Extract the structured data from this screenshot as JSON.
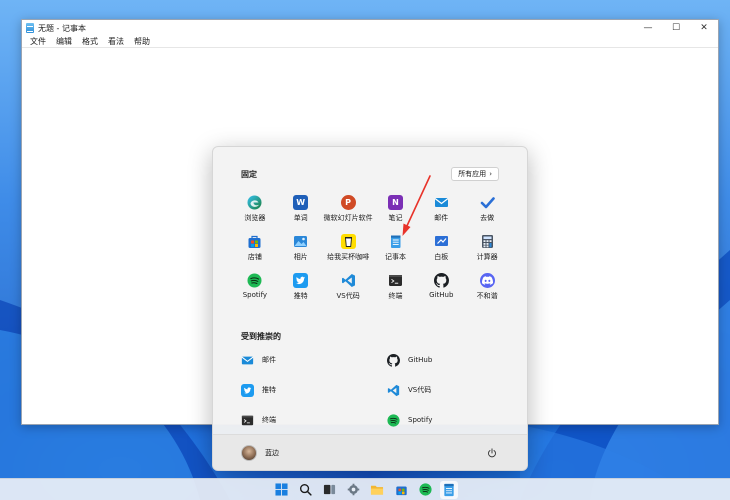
{
  "notepad": {
    "title": "无题 - 记事本",
    "menu": [
      "文件",
      "编辑",
      "格式",
      "看法",
      "帮助"
    ],
    "controls": {
      "minimize": "—",
      "maximize": "☐",
      "close": "✕"
    }
  },
  "start_menu": {
    "pinned_title": "固定",
    "all_apps_label": "所有应用",
    "all_apps_chevron": "›",
    "pinned": [
      {
        "label": "浏览器",
        "icon": "edge-icon"
      },
      {
        "label": "单词",
        "icon": "word-icon"
      },
      {
        "label": "微软幻灯片软件",
        "icon": "powerpoint-icon"
      },
      {
        "label": "笔记",
        "icon": "onenote-icon"
      },
      {
        "label": "邮件",
        "icon": "mail-icon"
      },
      {
        "label": "去做",
        "icon": "todo-icon"
      },
      {
        "label": "店铺",
        "icon": "store-icon"
      },
      {
        "label": "相片",
        "icon": "photos-icon"
      },
      {
        "label": "给我买杯咖啡",
        "icon": "coffee-icon"
      },
      {
        "label": "记事本",
        "icon": "notepad-icon"
      },
      {
        "label": "白板",
        "icon": "whiteboard-icon"
      },
      {
        "label": "计算器",
        "icon": "calculator-icon"
      },
      {
        "label": "Spotify",
        "icon": "spotify-icon"
      },
      {
        "label": "推特",
        "icon": "twitter-icon"
      },
      {
        "label": "VS代码",
        "icon": "vscode-icon"
      },
      {
        "label": "终端",
        "icon": "terminal-icon"
      },
      {
        "label": "GitHub",
        "icon": "github-icon"
      },
      {
        "label": "不和谐",
        "icon": "discord-icon"
      }
    ],
    "recommended_title": "受到推崇的",
    "recommended": [
      {
        "label": "邮件",
        "icon": "mail-icon"
      },
      {
        "label": "GitHub",
        "icon": "github-icon"
      },
      {
        "label": "推特",
        "icon": "twitter-icon"
      },
      {
        "label": "VS代码",
        "icon": "vscode-icon"
      },
      {
        "label": "终端",
        "icon": "terminal-icon"
      },
      {
        "label": "Spotify",
        "icon": "spotify-icon"
      }
    ],
    "user_name": "蓝边"
  },
  "taskbar": {
    "items": [
      "start-icon",
      "search-icon",
      "task-view-icon",
      "settings-icon",
      "file-explorer-icon",
      "store-icon",
      "spotify-icon",
      "notepad-icon"
    ],
    "active": "notepad-icon"
  },
  "colors": {
    "accent": "#0067c0",
    "annotation_arrow": "#e8332a",
    "wallpaper_blue": "#1f5fc4"
  }
}
